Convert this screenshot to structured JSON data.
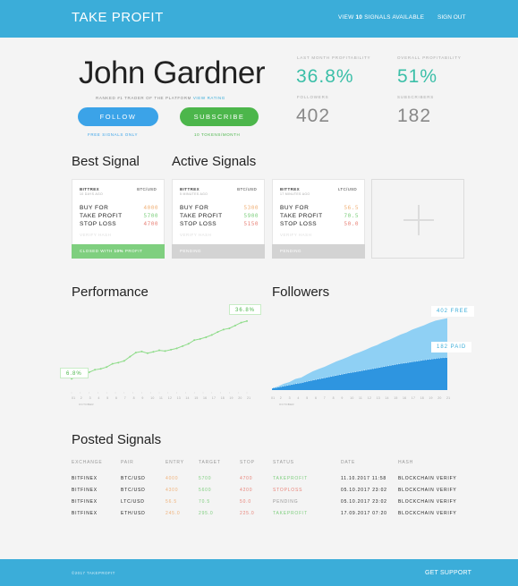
{
  "header": {
    "brand": "TAKE PROFIT",
    "signals_prefix": "VIEW",
    "signals_count": "10",
    "signals_suffix": "SIGNALS AVAILABLE",
    "signout": "SIGN OUT"
  },
  "profile": {
    "name": "John Gardner",
    "rank_prefix": "RANKED #1 TRADER OF THE PLATFORM",
    "rank_link": "VIEW RATING",
    "follow_label": "FOLLOW",
    "follow_note": "FREE SIGNALS ONLY",
    "subscribe_label": "SUBSCRIBE",
    "subscribe_note": "10 TOKENS/MONTH"
  },
  "stats": {
    "last_month_label": "LAST MONTH PROFITABILITY",
    "last_month_value": "36.8%",
    "overall_label": "OVERALL PROFITABILITY",
    "overall_value": "51%",
    "followers_label": "FOLLOWERS",
    "followers_value": "402",
    "subscribers_label": "SUBSCRIBERS",
    "subscribers_value": "182"
  },
  "sections": {
    "best_signal": "Best Signal",
    "active_signals": "Active Signals",
    "performance": "Performance",
    "followers": "Followers",
    "posted_signals": "Posted Signals"
  },
  "colors": {
    "accent": "#3badd9",
    "green": "#4cb64b",
    "profit_green": "#7fcf7f",
    "orange": "#f0b27a",
    "red": "#e8847a",
    "teal": "#3bbfa8",
    "pending_gray": "#d3d3d3",
    "followers_light": "#8fd0f4",
    "followers_dark": "#2e95e0"
  },
  "cards": [
    {
      "exchange": "BITTREX",
      "pair": "BTC/USD",
      "ago": "10 DAYS AGO",
      "buy_label": "BUY FOR",
      "buy": "4000",
      "tp_label": "TAKE PROFIT",
      "tp": "5700",
      "sl_label": "STOP LOSS",
      "sl": "4700",
      "hash": "VERIFY HASH",
      "status_pre": "CLOSED WITH",
      "status_bold": "10%",
      "status_post": "PROFIT"
    },
    {
      "exchange": "BITTREX",
      "pair": "BTC/USD",
      "ago": "5 MINUTES AGO",
      "buy_label": "BUY FOR",
      "buy": "5300",
      "tp_label": "TAKE PROFIT",
      "tp": "5900",
      "sl_label": "STOP LOSS",
      "sl": "5150",
      "hash": "VERIFY HASH",
      "status_pre": "PENDING",
      "status_bold": "",
      "status_post": ""
    },
    {
      "exchange": "BITTREX",
      "pair": "LTC/USD",
      "ago": "17 MINUTES AGO",
      "buy_label": "BUY FOR",
      "buy": "56.5",
      "tp_label": "TAKE PROFIT",
      "tp": "70.5",
      "sl_label": "STOP LOSS",
      "sl": "50.0",
      "hash": "VERIFY HASH",
      "status_pre": "PENDING",
      "status_bold": "",
      "status_post": ""
    }
  ],
  "chart_data": [
    {
      "type": "line",
      "title": "Performance",
      "x": [
        1,
        2,
        3,
        4,
        5,
        6,
        7,
        8,
        9,
        10,
        11,
        12,
        13,
        14,
        15,
        16,
        17,
        18,
        19,
        20,
        21,
        22,
        23,
        24,
        25,
        26,
        27,
        28,
        29,
        30,
        31
      ],
      "xlabel": "OCTOBER",
      "series": [
        {
          "values": [
            6.8,
            8.1,
            9.6,
            10.2,
            11.5,
            12.0,
            12.9,
            14.6,
            15.2,
            16.1,
            18.3,
            20.4,
            21.0,
            20.1,
            20.8,
            21.6,
            21.2,
            21.9,
            22.6,
            23.8,
            25.0,
            26.9,
            27.5,
            28.4,
            29.6,
            31.1,
            32.4,
            33.0,
            34.5,
            36.0,
            36.8
          ]
        }
      ],
      "start_label": "6.8%",
      "end_label": "36.8%",
      "ylim": [
        0,
        40
      ]
    },
    {
      "type": "area",
      "title": "Followers",
      "x": [
        1,
        2,
        3,
        4,
        5,
        6,
        7,
        8,
        9,
        10,
        11,
        12,
        13,
        14,
        15,
        16,
        17,
        18,
        19,
        20,
        21,
        22,
        23,
        24,
        25,
        26,
        27,
        28,
        29,
        30,
        31
      ],
      "xlabel": "OCTOBER",
      "series": [
        {
          "name": "FREE",
          "values": [
            10,
            20,
            35,
            45,
            62,
            70,
            88,
            105,
            118,
            130,
            145,
            160,
            172,
            185,
            200,
            212,
            225,
            240,
            252,
            268,
            280,
            295,
            310,
            322,
            338,
            350,
            362,
            376,
            388,
            395,
            402
          ]
        },
        {
          "name": "PAID",
          "values": [
            10,
            15,
            22,
            28,
            35,
            40,
            48,
            55,
            62,
            68,
            75,
            82,
            88,
            95,
            100,
            106,
            112,
            118,
            124,
            130,
            136,
            142,
            148,
            152,
            158,
            162,
            168,
            172,
            176,
            180,
            182
          ]
        }
      ],
      "free_label": "402 FREE",
      "paid_label": "182 PAID",
      "ylim": [
        0,
        460
      ]
    }
  ],
  "x_ticks": [
    "01",
    "2",
    "3",
    "4",
    "5",
    "6",
    "7",
    "8",
    "9",
    "10",
    "11",
    "12",
    "13",
    "14",
    "15",
    "16",
    "17",
    "18",
    "19",
    "20",
    "21"
  ],
  "month_label": "OCTOBER",
  "table": {
    "headers": [
      "EXCHANGE",
      "PAIR",
      "ENTRY",
      "TARGET",
      "STOP",
      "STATUS",
      "DATE",
      "HASH"
    ],
    "rows": [
      [
        "BITFINEX",
        "BTC/USD",
        "4000",
        "5700",
        "4700",
        "TAKEPROFIT",
        "11.10.2017 11:58",
        "BLOCKCHAIN VERIFY"
      ],
      [
        "BITFINEX",
        "BTC/USD",
        "4300",
        "5600",
        "4200",
        "STOPLOSS",
        "05.10.2017 23:02",
        "BLOCKCHAIN VERIFY"
      ],
      [
        "BITFINEX",
        "LTC/USD",
        "56.5",
        "70.5",
        "50.0",
        "PENDING",
        "05.10.2017 23:02",
        "BLOCKCHAIN VERIFY"
      ],
      [
        "BITFINEX",
        "ETH/USD",
        "245.0",
        "295.0",
        "225.0",
        "TAKEPROFIT",
        "17.09.2017 07:20",
        "BLOCKCHAIN VERIFY"
      ]
    ]
  },
  "footer": {
    "copyright": "©2017 TAKEPROFIT",
    "support": "GET SUPPORT"
  }
}
